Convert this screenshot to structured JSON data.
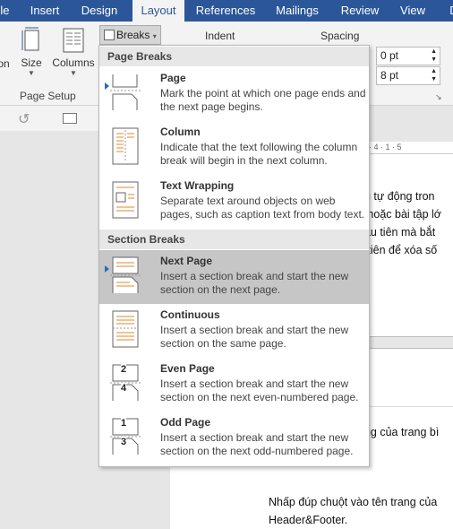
{
  "tabs": [
    {
      "label": "File"
    },
    {
      "label": "Insert"
    },
    {
      "label": "Design"
    },
    {
      "label": "Layout"
    },
    {
      "label": "References"
    },
    {
      "label": "Mailings"
    },
    {
      "label": "Review"
    },
    {
      "label": "View"
    },
    {
      "label": "D"
    }
  ],
  "ribbon": {
    "orientation_partial": "on",
    "size_label": "Size",
    "columns_label": "Columns",
    "breaks_label": "Breaks",
    "page_setup_label": "Page Setup",
    "indent_label": "Indent",
    "spacing_label": "Spacing",
    "spacing_before": "0 pt",
    "spacing_after": "8 pt"
  },
  "ruler": {
    "text": "· 4 · 1 · 5"
  },
  "document": {
    "line1": "ng tự động tron",
    "line2": "o hoặc bài tập lớ",
    "line3": "đầu tiên mà bắt",
    "line4": "u tiên để xóa số",
    "line5": "ang của trang bì",
    "line6": "Nhấp đúp chuột vào tên trang của",
    "line7": "Header&Footer."
  },
  "menu": {
    "page_breaks_header": "Page Breaks",
    "section_breaks_header": "Section Breaks",
    "items": [
      {
        "title": "Page",
        "desc": "Mark the point at which one page ends and the next page begins."
      },
      {
        "title": "Column",
        "desc": "Indicate that the text following the column break will begin in the next column."
      },
      {
        "title": "Text Wrapping",
        "desc": "Separate text around objects on web pages, such as caption text from body text."
      },
      {
        "title": "Next Page",
        "desc": "Insert a section break and start the new section on the next page."
      },
      {
        "title": "Continuous",
        "desc": "Insert a section break and start the new section on the same page."
      },
      {
        "title": "Even Page",
        "desc": "Insert a section break and start the new section on the next even-numbered page."
      },
      {
        "title": "Odd Page",
        "desc": "Insert a section break and start the new section on the next odd-numbered page."
      }
    ],
    "even_num": "2",
    "even_num2": "4",
    "odd_num": "1",
    "odd_num2": "3"
  },
  "colors": {
    "accent": "#2b579a",
    "highlight": "#c6c6c6"
  }
}
